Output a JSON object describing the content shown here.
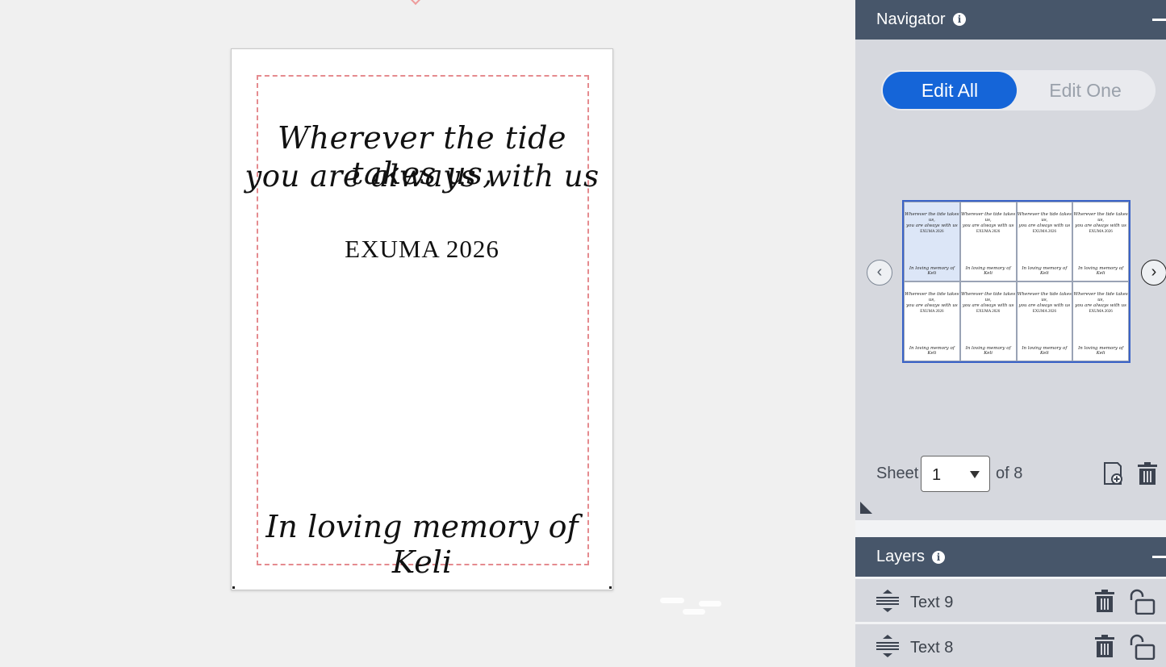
{
  "card": {
    "quote_line1": "Wherever the tide takes us,",
    "quote_line2": "you are always with us",
    "event": "EXUMA 2026",
    "memory": "In loving memory of Keli"
  },
  "navigator": {
    "title": "Navigator",
    "edit_all_label": "Edit All",
    "edit_one_label": "Edit One",
    "mode_selected": "Edit All",
    "thumbnails": [
      {
        "quote_line1": "Wherever the tide takes us,",
        "quote_line2": "you are always with us",
        "event": "EXUMA 2026",
        "memory": "In loving memory of Keli",
        "selected": true
      },
      {
        "quote_line1": "Wherever the tide takes us,",
        "quote_line2": "you are always with us",
        "event": "EXUMA 2026",
        "memory": "In loving memory of Keli",
        "selected": false
      },
      {
        "quote_line1": "Wherever the tide takes us,",
        "quote_line2": "you are always with us",
        "event": "EXUMA 2026",
        "memory": "In loving memory of Keli",
        "selected": false
      },
      {
        "quote_line1": "Wherever the tide takes us,",
        "quote_line2": "you are always with us",
        "event": "EXUMA 2026",
        "memory": "In loving memory of Keli",
        "selected": false
      },
      {
        "quote_line1": "Wherever the tide takes us,",
        "quote_line2": "you are always with us",
        "event": "EXUMA 2026",
        "memory": "In loving memory of Keli",
        "selected": false
      },
      {
        "quote_line1": "Wherever the tide takes us,",
        "quote_line2": "you are always with us",
        "event": "EXUMA 2026",
        "memory": "In loving memory of Keli",
        "selected": false
      },
      {
        "quote_line1": "Wherever the tide takes us,",
        "quote_line2": "you are always with us",
        "event": "EXUMA 2026",
        "memory": "In loving memory of Keli",
        "selected": false
      },
      {
        "quote_line1": "Wherever the tide takes us,",
        "quote_line2": "you are always with us",
        "event": "EXUMA 2026",
        "memory": "In loving memory of Keli",
        "selected": false
      }
    ],
    "sheet_label": "Sheet",
    "sheet_value": "1",
    "sheet_of": "of 8"
  },
  "layers": {
    "title": "Layers",
    "items": [
      {
        "label": "Text 9"
      },
      {
        "label": "Text 8"
      }
    ]
  },
  "icons": {
    "info": "info-icon",
    "minimize": "minus-icon",
    "prev": "chevron-left-icon",
    "next": "chevron-right-icon",
    "add_sheet": "add-sheet-icon",
    "delete": "trash-icon",
    "drag": "drag-handle-icon",
    "lock": "unlock-icon"
  },
  "colors": {
    "panel_header": "#47566a",
    "panel_body": "#d6d8de",
    "accent": "#1565d8",
    "safe_area_border": "#e58b8f",
    "thumb_selected": "#dce6f7"
  }
}
